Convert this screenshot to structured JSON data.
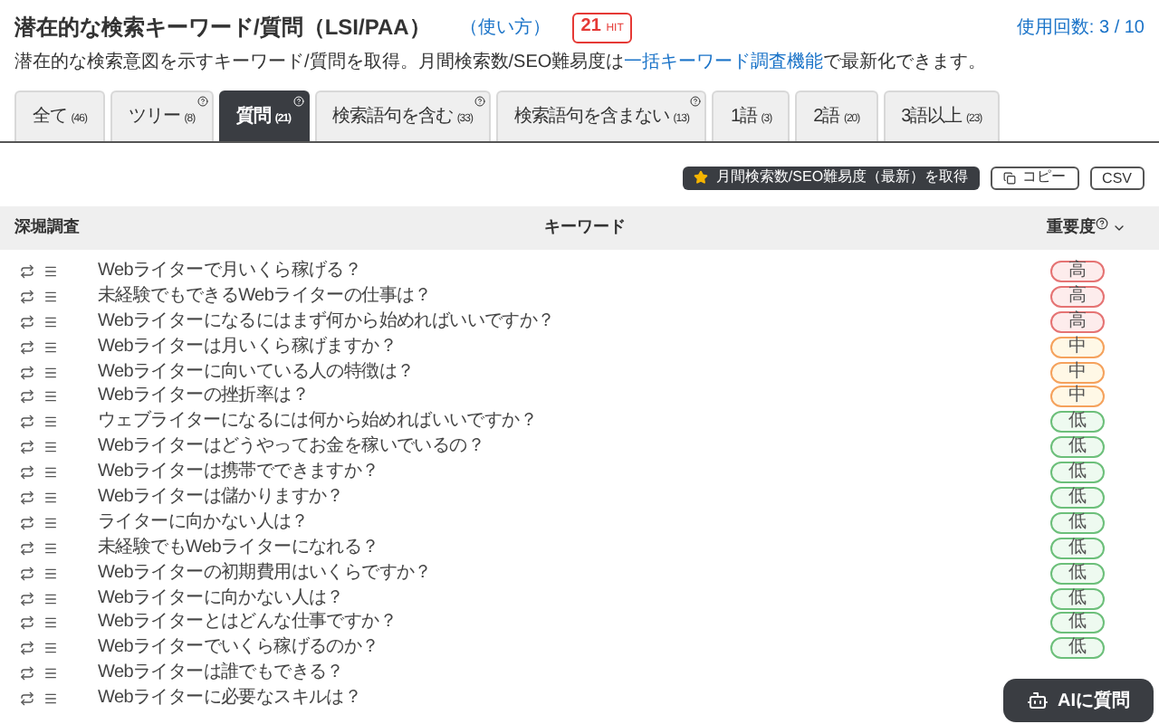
{
  "header": {
    "title": "潜在的な検索キーワード/質問（LSI/PAA）",
    "help_link": "（使い方）",
    "hit_badge": "21",
    "hit_unit": "HIT",
    "usage": "使用回数: 3 / 10"
  },
  "description": {
    "before": "潜在的な検索意図を示すキーワード/質問を取得。月間検索数/SEO難易度は",
    "link": "一括キーワード調査機能",
    "after": "で最新化できます。"
  },
  "tabs": [
    {
      "label": "全て",
      "count": "(46)",
      "selected": false,
      "help": false
    },
    {
      "label": "ツリー",
      "count": "(8)",
      "selected": false,
      "help": true
    },
    {
      "label": "質問",
      "count": "(21)",
      "selected": true,
      "help": true
    },
    {
      "label": "検索語句を含む",
      "count": "(33)",
      "selected": false,
      "help": true
    },
    {
      "label": "検索語句を含まない",
      "count": "(13)",
      "selected": false,
      "help": true
    },
    {
      "label": "1語",
      "count": "(3)",
      "selected": false,
      "help": false
    },
    {
      "label": "2語",
      "count": "(20)",
      "selected": false,
      "help": false
    },
    {
      "label": "3語以上",
      "count": "(23)",
      "selected": false,
      "help": false
    }
  ],
  "actions": {
    "fetch": "月間検索数/SEO難易度（最新）を取得",
    "copy": "コピー",
    "csv": "CSV"
  },
  "table": {
    "columns": [
      "深堀調査",
      "キーワード",
      "重要度"
    ],
    "rows": [
      {
        "keyword": "Webライターで月いくら稼げる？",
        "priority": "高",
        "kind": "high"
      },
      {
        "keyword": "未経験でもできるWebライターの仕事は？",
        "priority": "高",
        "kind": "high"
      },
      {
        "keyword": "Webライターになるにはまず何から始めればいいですか？",
        "priority": "高",
        "kind": "high"
      },
      {
        "keyword": "Webライターは月いくら稼げますか？",
        "priority": "中",
        "kind": "mid"
      },
      {
        "keyword": "Webライターに向いている人の特徴は？",
        "priority": "中",
        "kind": "mid"
      },
      {
        "keyword": "Webライターの挫折率は？",
        "priority": "中",
        "kind": "mid"
      },
      {
        "keyword": "ウェブライターになるには何から始めればいいですか？",
        "priority": "低",
        "kind": "low"
      },
      {
        "keyword": "Webライターはどうやってお金を稼いでいるの？",
        "priority": "低",
        "kind": "low"
      },
      {
        "keyword": "Webライターは携帯でできますか？",
        "priority": "低",
        "kind": "low"
      },
      {
        "keyword": "Webライターは儲かりますか？",
        "priority": "低",
        "kind": "low"
      },
      {
        "keyword": "ライターに向かない人は？",
        "priority": "低",
        "kind": "low"
      },
      {
        "keyword": "未経験でもWebライターになれる？",
        "priority": "低",
        "kind": "low"
      },
      {
        "keyword": "Webライターの初期費用はいくらですか？",
        "priority": "低",
        "kind": "low"
      },
      {
        "keyword": "Webライターに向かない人は？",
        "priority": "低",
        "kind": "low"
      },
      {
        "keyword": "Webライターとはどんな仕事ですか？",
        "priority": "低",
        "kind": "low"
      },
      {
        "keyword": "Webライターでいくら稼げるのか？",
        "priority": "低",
        "kind": "low"
      },
      {
        "keyword": "Webライターは誰でもできる？"
      },
      {
        "keyword": "Webライターに必要なスキルは？"
      }
    ]
  },
  "ai_button": "AIに質問"
}
